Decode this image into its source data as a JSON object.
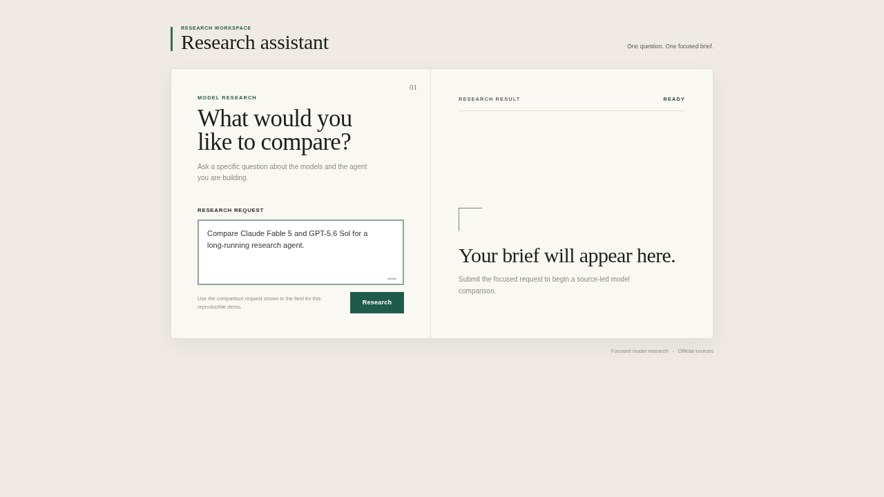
{
  "header": {
    "eyebrow": "RESEARCH WORKSPACE",
    "title": "Research assistant",
    "tagline": "One question. One focused brief."
  },
  "request_panel": {
    "step": "01",
    "eyebrow": "MODEL RESEARCH",
    "heading": "What would you like to compare?",
    "description": "Ask a specific question about the models and the agent you are building.",
    "field_label": "RESEARCH REQUEST",
    "field_value": "Compare Claude Fable 5 and GPT-5.6 Sol for a long-running research agent.",
    "hint": "Use the comparison request shown in the field for this reproducible demo.",
    "button": "Research"
  },
  "result_panel": {
    "eyebrow": "RESEARCH RESULT",
    "status": "READY",
    "heading": "Your brief will appear here.",
    "description": "Submit the focused request to begin a source-led model comparison."
  },
  "footer": [
    "Focused model research",
    "·",
    "Official sources"
  ]
}
